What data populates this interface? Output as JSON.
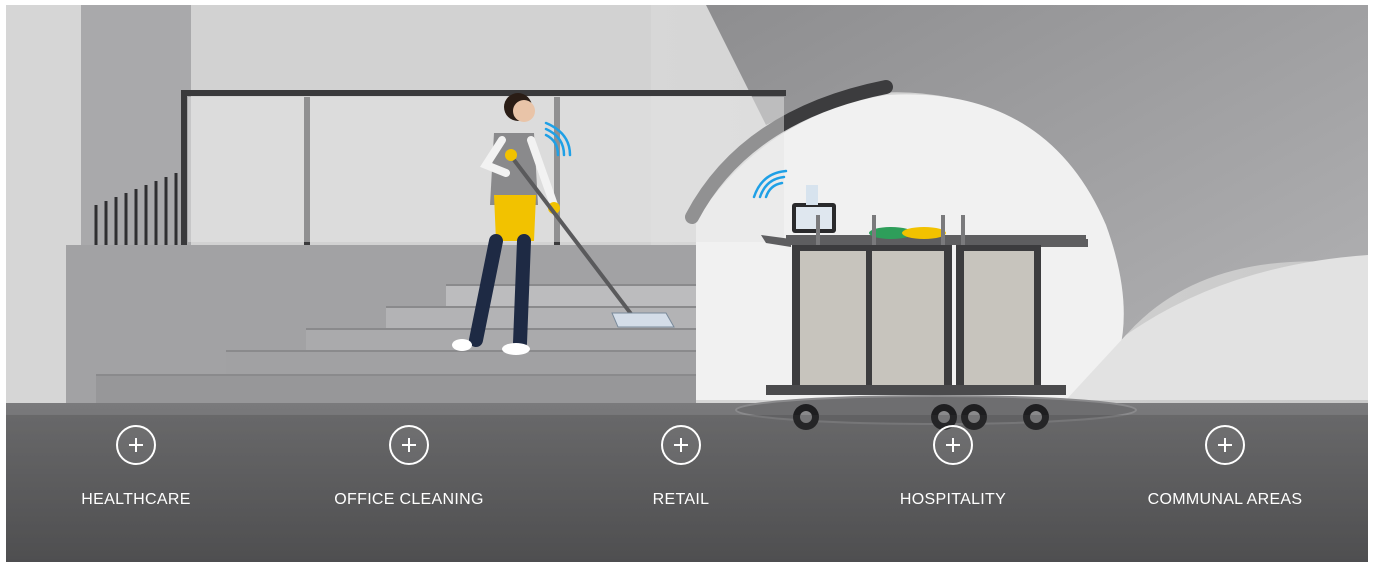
{
  "categories": [
    {
      "label": "HEALTHCARE"
    },
    {
      "label": "OFFICE CLEANING"
    },
    {
      "label": "RETAIL"
    },
    {
      "label": "HOSPITALITY"
    },
    {
      "label": "COMMUNAL AREAS"
    }
  ],
  "colors": {
    "accent_yellow": "#f2c200",
    "wifi_blue": "#1fa0e6",
    "floor": "#5e5e60"
  },
  "icons": [
    "plus-circle-icon",
    "wifi-signal-icon"
  ]
}
